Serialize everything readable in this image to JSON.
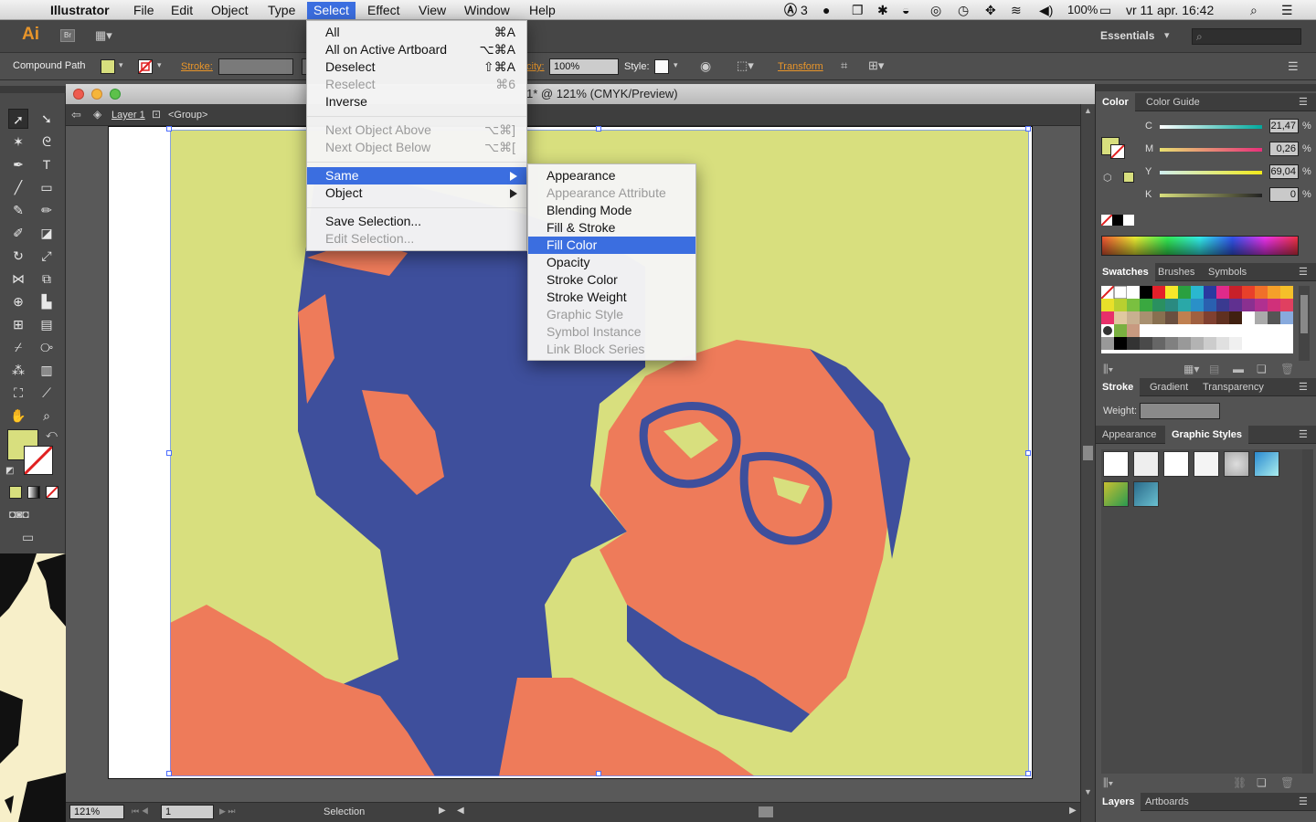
{
  "menubar": {
    "app": "Illustrator",
    "items": [
      "File",
      "Edit",
      "Object",
      "Type",
      "Select",
      "Effect",
      "View",
      "Window",
      "Help"
    ],
    "status": {
      "adobe_badge": "3",
      "battery": "100%",
      "datetime": "vr 11 apr.  16:42"
    }
  },
  "appbar": {
    "logo": "Ai",
    "bridge": "Br",
    "workspace": "Essentials"
  },
  "control": {
    "selection_type": "Compound Path",
    "stroke_label": "Stroke:",
    "opacity_label": "city:",
    "opacity_value": "100%",
    "style_label": "Style:",
    "transform_label": "Transform"
  },
  "document": {
    "title": "1* @ 121% (CMYK/Preview)",
    "layer": "Layer 1",
    "group": "<Group>"
  },
  "status_bar": {
    "zoom": "121%",
    "artboard": "1",
    "mode": "Selection"
  },
  "color_panel": {
    "tabs": [
      "Color",
      "Color Guide"
    ],
    "channels": [
      {
        "label": "C",
        "value": "21,47",
        "unit": "%"
      },
      {
        "label": "M",
        "value": "0,26",
        "unit": "%"
      },
      {
        "label": "Y",
        "value": "69,04",
        "unit": "%"
      },
      {
        "label": "K",
        "value": "0",
        "unit": "%"
      }
    ]
  },
  "swatches_panel": {
    "tabs": [
      "Swatches",
      "Brushes",
      "Symbols"
    ]
  },
  "stroke_panel": {
    "tabs": [
      "Stroke",
      "Gradient",
      "Transparency"
    ],
    "weight_label": "Weight:"
  },
  "styles_panel": {
    "tabs": [
      "Appearance",
      "Graphic Styles"
    ]
  },
  "layers_panel": {
    "tabs": [
      "Layers",
      "Artboards"
    ]
  },
  "select_menu": {
    "items": [
      {
        "label": "All",
        "shortcut": "⌘A",
        "disabled": false
      },
      {
        "label": "All on Active Artboard",
        "shortcut": "⌥⌘A",
        "disabled": false
      },
      {
        "label": "Deselect",
        "shortcut": "⇧⌘A",
        "disabled": false
      },
      {
        "label": "Reselect",
        "shortcut": "⌘6",
        "disabled": true
      },
      {
        "label": "Inverse",
        "shortcut": "",
        "disabled": false
      },
      {
        "label": "Next Object Above",
        "shortcut": "⌥⌘]",
        "disabled": true
      },
      {
        "label": "Next Object Below",
        "shortcut": "⌥⌘[",
        "disabled": true
      },
      {
        "label": "Same",
        "shortcut": "",
        "disabled": false,
        "submenu": true,
        "highlighted": true
      },
      {
        "label": "Object",
        "shortcut": "",
        "disabled": false,
        "submenu": true
      },
      {
        "label": "Save Selection...",
        "shortcut": "",
        "disabled": false
      },
      {
        "label": "Edit Selection...",
        "shortcut": "",
        "disabled": true
      }
    ]
  },
  "same_submenu": {
    "items": [
      {
        "label": "Appearance",
        "disabled": false
      },
      {
        "label": "Appearance Attribute",
        "disabled": true
      },
      {
        "label": "Blending Mode",
        "disabled": false
      },
      {
        "label": "Fill & Stroke",
        "disabled": false
      },
      {
        "label": "Fill Color",
        "disabled": false,
        "highlighted": true
      },
      {
        "label": "Opacity",
        "disabled": false
      },
      {
        "label": "Stroke Color",
        "disabled": false
      },
      {
        "label": "Stroke Weight",
        "disabled": false
      },
      {
        "label": "Graphic Style",
        "disabled": true
      },
      {
        "label": "Symbol Instance",
        "disabled": true
      },
      {
        "label": "Link Block Series",
        "disabled": true
      }
    ]
  },
  "colors": {
    "artwork_bg": "#d8df7e",
    "artwork_orange": "#ee7b5a",
    "artwork_blue": "#3e4f9c",
    "menu_highlight": "#3b6ee0"
  }
}
